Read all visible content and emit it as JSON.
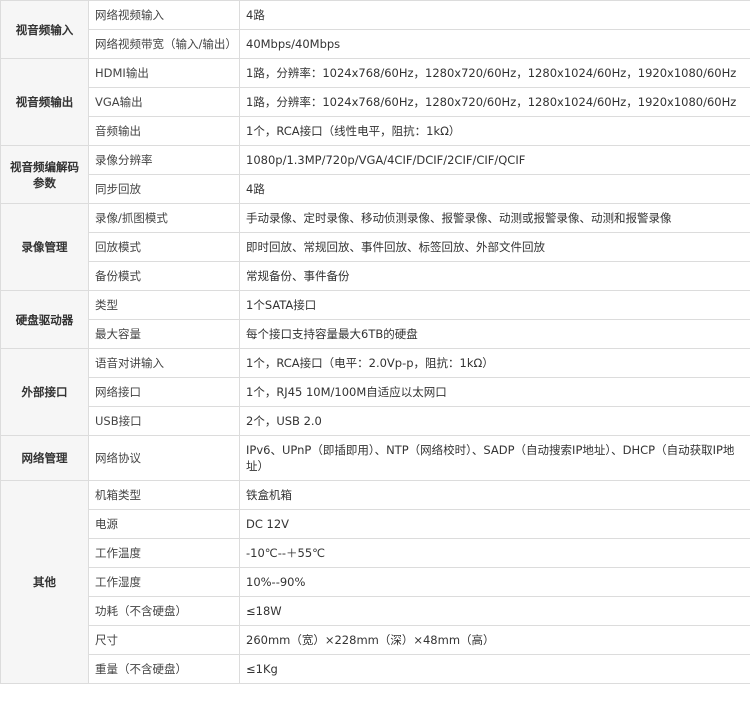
{
  "sections": [
    {
      "title": "视音频输入",
      "rows": [
        {
          "key": "网络视频输入",
          "value": "4路"
        },
        {
          "key": "网络视频带宽（输入/输出）",
          "value": "40Mbps/40Mbps"
        }
      ]
    },
    {
      "title": "视音频输出",
      "rows": [
        {
          "key": "HDMI输出",
          "value": "1路，分辨率：1024x768/60Hz，1280x720/60Hz，1280x1024/60Hz，1920x1080/60Hz"
        },
        {
          "key": "VGA输出",
          "value": "1路，分辨率：1024x768/60Hz，1280x720/60Hz，1280x1024/60Hz，1920x1080/60Hz"
        },
        {
          "key": "音频输出",
          "value": "1个，RCA接口（线性电平，阻抗：1kΩ）"
        }
      ]
    },
    {
      "title": "视音频编解码参数",
      "rows": [
        {
          "key": "录像分辨率",
          "value": "1080p/1.3MP/720p/VGA/4CIF/DCIF/2CIF/CIF/QCIF"
        },
        {
          "key": "同步回放",
          "value": "4路"
        }
      ]
    },
    {
      "title": "录像管理",
      "rows": [
        {
          "key": "录像/抓图模式",
          "value": "手动录像、定时录像、移动侦测录像、报警录像、动测或报警录像、动测和报警录像"
        },
        {
          "key": "回放模式",
          "value": "即时回放、常规回放、事件回放、标签回放、外部文件回放"
        },
        {
          "key": "备份模式",
          "value": "常规备份、事件备份"
        }
      ]
    },
    {
      "title": "硬盘驱动器",
      "rows": [
        {
          "key": "类型",
          "value": "1个SATA接口"
        },
        {
          "key": "最大容量",
          "value": "每个接口支持容量最大6TB的硬盘"
        }
      ]
    },
    {
      "title": "外部接口",
      "rows": [
        {
          "key": "语音对讲输入",
          "value": "1个，RCA接口（电平：2.0Vp-p，阻抗：1kΩ）"
        },
        {
          "key": "网络接口",
          "value": "1个，RJ45 10M/100M自适应以太网口"
        },
        {
          "key": "USB接口",
          "value": "2个，USB 2.0"
        }
      ]
    },
    {
      "title": "网络管理",
      "rows": [
        {
          "key": "网络协议",
          "value": "IPv6、UPnP（即插即用）、NTP（网络校时）、SADP（自动搜索IP地址）、DHCP（自动获取IP地址）"
        }
      ]
    },
    {
      "title": "其他",
      "rows": [
        {
          "key": "机箱类型",
          "value": "铁盒机箱"
        },
        {
          "key": "电源",
          "value": "DC 12V"
        },
        {
          "key": "工作温度",
          "value": "-10℃--＋55℃"
        },
        {
          "key": "工作湿度",
          "value": "10%--90%"
        },
        {
          "key": "功耗（不含硬盘）",
          "value": "≤18W"
        },
        {
          "key": "尺寸",
          "value": "260mm（宽）×228mm（深）×48mm（高）"
        },
        {
          "key": "重量（不含硬盘）",
          "value": "≤1Kg"
        }
      ]
    }
  ]
}
